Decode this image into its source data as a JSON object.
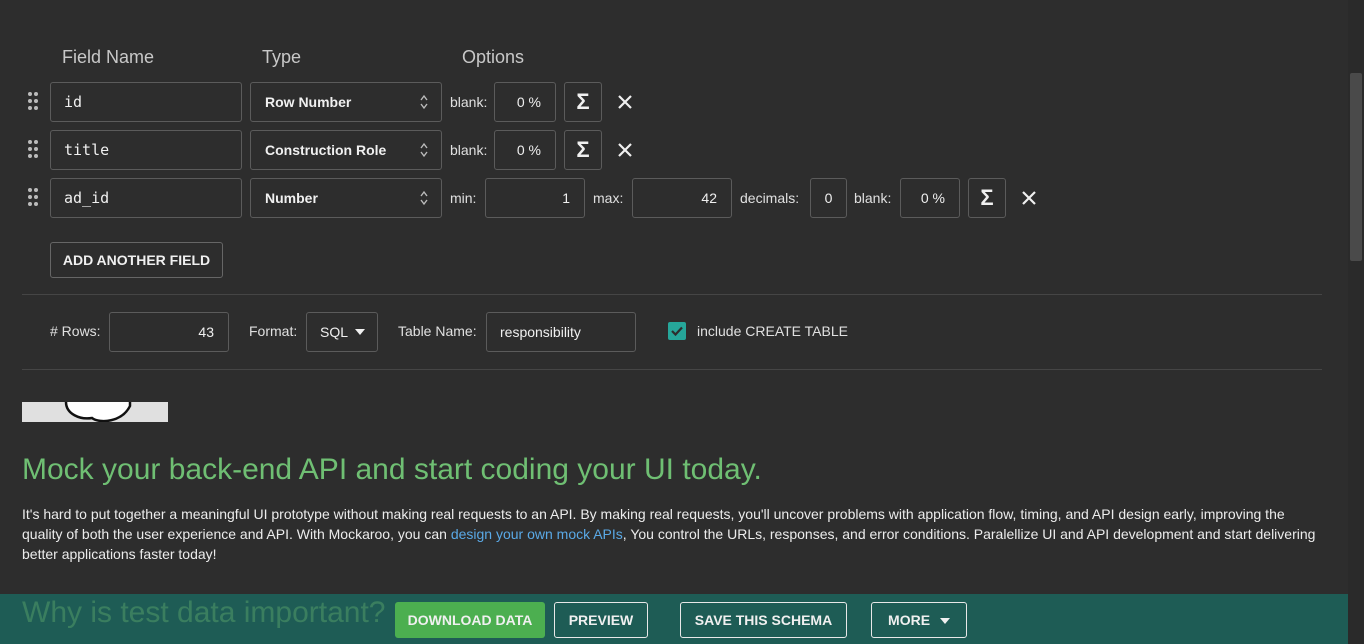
{
  "columns": {
    "field_name": "Field Name",
    "type": "Type",
    "options": "Options"
  },
  "fields": [
    {
      "name": "id",
      "type": "Row Number",
      "blank_label": "blank:",
      "blank_value": "0 %"
    },
    {
      "name": "title",
      "type": "Construction Role",
      "blank_label": "blank:",
      "blank_value": "0 %"
    },
    {
      "name": "ad_id",
      "type": "Number",
      "min_label": "min:",
      "min_value": "1",
      "max_label": "max:",
      "max_value": "42",
      "decimals_label": "decimals:",
      "decimals_value": "0",
      "blank_label": "blank:",
      "blank_value": "0 %"
    }
  ],
  "sigma_glyph": "Σ",
  "add_field_label": "ADD ANOTHER FIELD",
  "settings": {
    "rows_label": "# Rows:",
    "rows_value": "43",
    "format_label": "Format:",
    "format_value": "SQL",
    "table_name_label": "Table Name:",
    "table_name_value": "responsibility",
    "create_table_label": "include CREATE TABLE",
    "create_table_checked": true
  },
  "promo": {
    "heading": "Mock your back-end API and start coding your UI today.",
    "text_1": "It's hard to put together a meaningful UI prototype without making real requests to an API. By making real requests, you'll uncover problems with application flow, timing, and API design early, improving the quality of both the user experience and API. With Mockaroo, you can ",
    "link": "design your own mock APIs",
    "text_2": ", You control the URLs, responses, and error conditions. Paralellize UI and API development and start delivering better applications faster today!",
    "next_heading": "Why is test data important?"
  },
  "footer": {
    "download": "DOWNLOAD DATA",
    "preview": "PREVIEW",
    "save": "SAVE THIS SCHEMA",
    "more": "MORE"
  },
  "colors": {
    "accent_green": "#6fbf73",
    "download_button": "#4caf50",
    "footer_bar": "#1e5c55",
    "checkbox": "#26a69a",
    "link": "#5aa9e6"
  }
}
